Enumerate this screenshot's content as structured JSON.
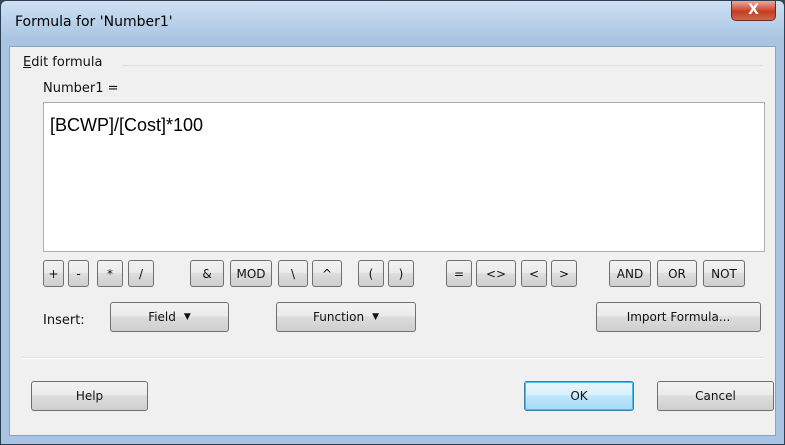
{
  "window": {
    "title": "Formula for 'Number1'",
    "close_label": "X"
  },
  "group": {
    "label_accel": "E",
    "label_rest": "dit formula"
  },
  "field_label": "Number1 =",
  "formula": "[BCWP]/[Cost]*100",
  "operators": [
    "+",
    "-",
    "*",
    "/",
    "&",
    "MOD",
    "\\",
    "^",
    "(",
    ")",
    "=",
    "<>",
    "<",
    ">",
    "AND",
    "OR",
    "NOT"
  ],
  "insert": {
    "label": "Insert:",
    "field_button": "Field",
    "function_button": "Function",
    "import_button": "Import Formula..."
  },
  "footer": {
    "help": "Help",
    "ok": "OK",
    "cancel": "Cancel"
  },
  "colors": {
    "client_bg": "#f0f0f0",
    "titlebar": "#b9d1ea",
    "close_button": "#c43c22",
    "default_button_border": "#3c7fb1"
  }
}
